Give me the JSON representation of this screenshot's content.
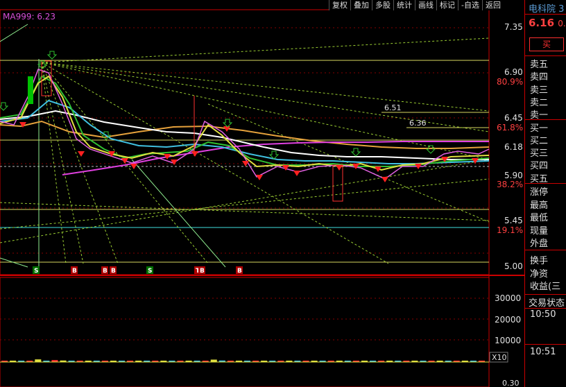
{
  "toolbar": [
    "复权",
    "叠加",
    "多股",
    "统计",
    "画线",
    "标记",
    "-自选",
    "返回"
  ],
  "ma_label": "MA999: 6.23",
  "price_axis": {
    "ticks": [
      "7.35",
      "6.90",
      "6.45",
      "6.18",
      "5.90",
      "5.45",
      "5.00"
    ],
    "fib_ratios": [
      "80.9%",
      "61.8%",
      "38.2%",
      "19.1%"
    ],
    "annotations": [
      "6.51",
      "6.36"
    ]
  },
  "volume_axis": {
    "ticks": [
      "30000",
      "20000",
      "10000"
    ],
    "unit": "X10",
    "bottom_label": "0.30"
  },
  "signals": [
    "S",
    "B",
    "B",
    "B",
    "S",
    "T",
    "B",
    "B"
  ],
  "right_panel": {
    "stock_name": "电科院 3",
    "price": "6.16",
    "change": "0.",
    "buy_button": "买",
    "order_book": [
      "卖五",
      "卖四",
      "卖三",
      "卖二",
      "卖一",
      "买一",
      "买二",
      "买三",
      "买四",
      "买五"
    ],
    "stats": [
      "涨停",
      "最高",
      "最低",
      "现量",
      "外盘",
      "换手",
      "净资",
      "收益(三"
    ],
    "section_title": "交易状态",
    "times": [
      "10:50",
      "10:51"
    ]
  },
  "colors": {
    "up": "#ff3030",
    "down": "#00c000",
    "panel_border": "#c00000",
    "ma_label": "#d84fd8"
  },
  "chart_data": {
    "type": "line",
    "title": "",
    "ylim": [
      5.0,
      7.35
    ],
    "y_ticks": [
      7.35,
      6.9,
      6.45,
      6.18,
      5.9,
      5.45,
      5.0
    ],
    "series": [
      {
        "name": "MA999",
        "values": [
          6.23
        ]
      }
    ],
    "close": [
      6.45,
      6.42,
      6.38,
      6.46,
      6.5,
      6.6,
      6.8,
      7.0,
      6.95,
      6.85,
      6.7,
      6.55,
      6.35,
      6.2,
      6.1,
      6.18,
      6.25,
      6.2,
      6.1,
      6.08,
      6.05,
      6.12,
      6.2,
      6.22,
      6.15,
      6.1,
      6.12,
      6.2,
      6.3,
      6.4,
      6.36,
      6.3,
      6.25,
      6.2,
      6.1,
      6.05,
      5.98,
      5.95,
      5.98,
      6.02,
      6.0,
      5.96,
      5.98,
      6.02,
      6.05,
      6.0,
      5.98,
      5.95,
      5.92,
      5.97,
      6.0,
      6.02,
      6.05,
      6.08,
      6.1,
      6.12,
      6.15,
      6.16
    ],
    "volume": [
      300,
      260,
      280,
      250,
      1200,
      600,
      900,
      700,
      500,
      400,
      300,
      260,
      240,
      300,
      260,
      240,
      220,
      200,
      210,
      220,
      230,
      240,
      260,
      280,
      300,
      1100,
      700,
      500,
      300,
      260,
      240,
      220,
      200,
      210,
      220,
      230,
      200,
      190,
      200,
      210,
      220,
      230,
      240,
      250,
      260,
      270,
      280,
      290,
      300,
      310,
      320,
      330,
      340,
      350,
      360,
      370,
      380,
      390
    ]
  }
}
